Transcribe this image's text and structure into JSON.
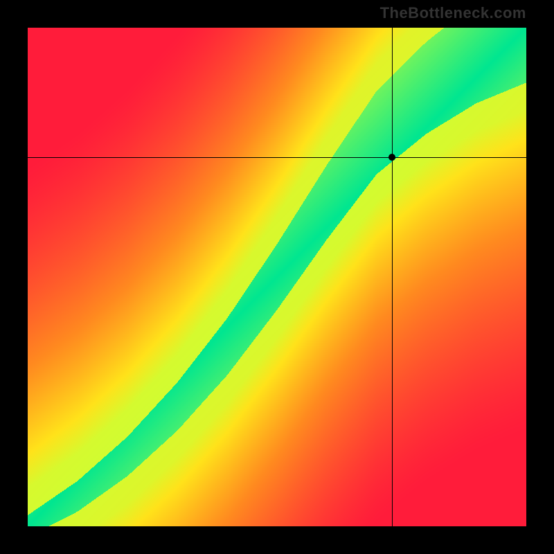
{
  "watermark": "TheBottleneck.com",
  "chart_data": {
    "type": "heatmap",
    "title": "",
    "xlabel": "",
    "ylabel": "",
    "xlim": [
      0,
      1
    ],
    "ylim": [
      0,
      1
    ],
    "grid": false,
    "legend": false,
    "crosshair": {
      "x": 0.73,
      "y": 0.74
    },
    "point": {
      "x": 0.73,
      "y": 0.74
    },
    "description": "2D red-yellow-green heatmap; green optimal band runs diagonally from bottom-left to top-right, curving upward; crosshair/point marks a location just below the green band on its right edge.",
    "colorscale": [
      {
        "value": 0.0,
        "color": "#ff1c3a"
      },
      {
        "value": 0.45,
        "color": "#ff8a1f"
      },
      {
        "value": 0.75,
        "color": "#ffe21a"
      },
      {
        "value": 0.92,
        "color": "#ccff33"
      },
      {
        "value": 1.0,
        "color": "#00e690"
      }
    ],
    "optimal_curve_points": [
      {
        "x": 0.0,
        "y": 0.0
      },
      {
        "x": 0.1,
        "y": 0.06
      },
      {
        "x": 0.2,
        "y": 0.14
      },
      {
        "x": 0.3,
        "y": 0.24
      },
      {
        "x": 0.4,
        "y": 0.36
      },
      {
        "x": 0.5,
        "y": 0.5
      },
      {
        "x": 0.6,
        "y": 0.65
      },
      {
        "x": 0.7,
        "y": 0.79
      },
      {
        "x": 0.8,
        "y": 0.88
      },
      {
        "x": 0.9,
        "y": 0.95
      },
      {
        "x": 1.0,
        "y": 1.0
      }
    ],
    "band_halfwidth": 0.055
  }
}
